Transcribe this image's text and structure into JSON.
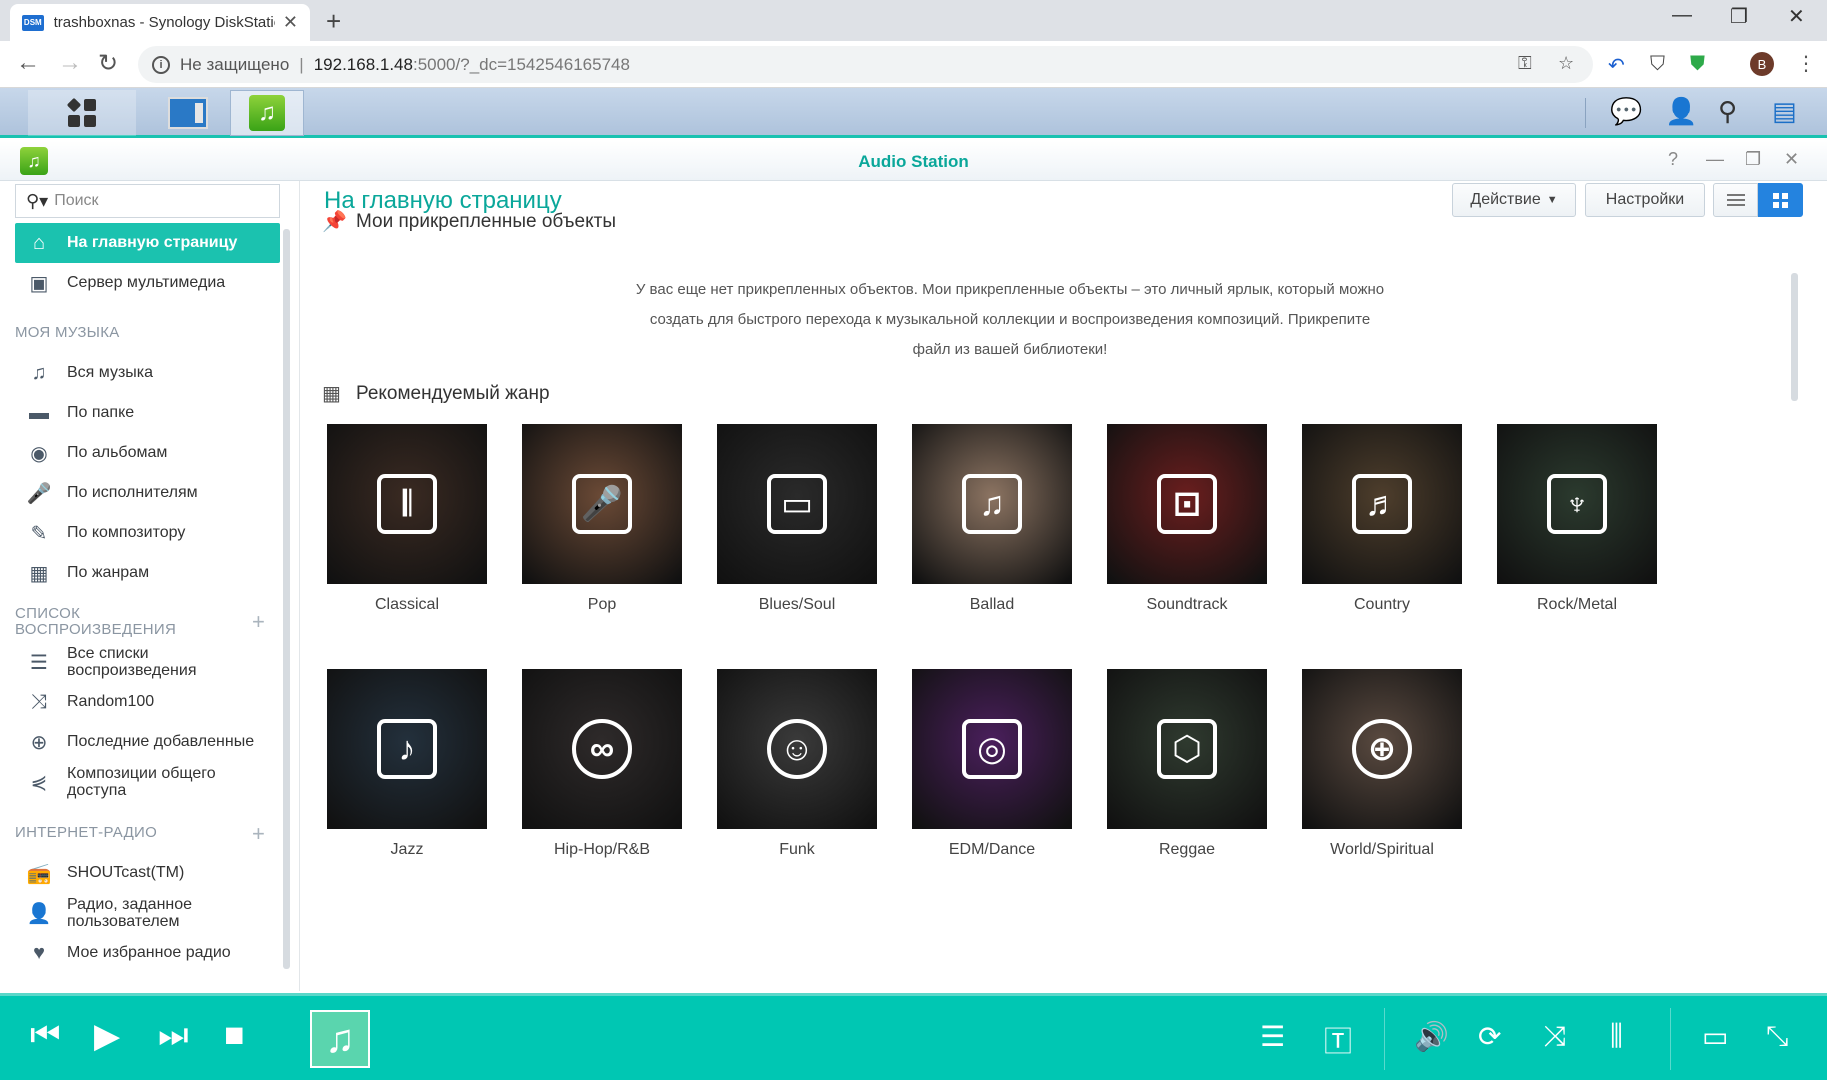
{
  "browser": {
    "tab_title": "trashboxnas - Synology DiskStation",
    "tab_favicon": "DSM",
    "security_label": "Не защищено",
    "url_host": "192.168.1.48",
    "url_path": ":5000/?_dc=1542546165748",
    "profile_letter": "B"
  },
  "app": {
    "title": "Audio Station"
  },
  "sidebar": {
    "search_placeholder": "Поиск",
    "top": [
      {
        "label": "На главную страницу",
        "icon": "home-icon",
        "active": true
      },
      {
        "label": "Сервер мультимедиа",
        "icon": "media-server-icon"
      }
    ],
    "my_music_header": "МОЯ МУЗЫКА",
    "my_music": [
      {
        "label": "Вся музыка",
        "icon": "music-note-icon"
      },
      {
        "label": "По папке",
        "icon": "folder-icon"
      },
      {
        "label": "По альбомам",
        "icon": "album-icon"
      },
      {
        "label": "По исполнителям",
        "icon": "microphone-icon"
      },
      {
        "label": "По композитору",
        "icon": "pen-icon"
      },
      {
        "label": "По жанрам",
        "icon": "genre-grid-icon"
      }
    ],
    "playlist_header": "СПИСОК ВОСПРОИЗВЕДЕНИЯ",
    "playlists": [
      {
        "label": "Все списки воспроизведения",
        "icon": "playlist-icon"
      },
      {
        "label": "Random100",
        "icon": "shuffle-icon"
      },
      {
        "label": "Последние добавленные",
        "icon": "plus-circle-icon"
      },
      {
        "label": "Композиции общего доступа",
        "icon": "share-icon"
      }
    ],
    "radio_header": "ИНТЕРНЕТ-РАДИО",
    "radio": [
      {
        "label": "SHOUTcast(TM)",
        "icon": "radio-icon"
      },
      {
        "label": "Радио, заданное пользователем",
        "icon": "user-icon"
      },
      {
        "label": "Мое избранное радио",
        "icon": "heart-icon"
      }
    ]
  },
  "main": {
    "page_title": "На главную страницу",
    "action_button": "Действие",
    "settings_button": "Настройки",
    "pinned_title": "Мои прикрепленные объекты",
    "pinned_empty": "У вас еще нет прикрепленных объектов. Мои прикрепленные объекты – это личный ярлык, который можно создать для быстрого перехода к музыкальной коллекции и воспроизведения композиций. Прикрепите файл из вашей библиотеки!",
    "genre_title": "Рекомендуемый жанр",
    "genres": [
      {
        "label": "Classical",
        "icon": "piano-icon",
        "color": "#3a2a22"
      },
      {
        "label": "Pop",
        "icon": "microphone-icon",
        "color": "#6b4a36"
      },
      {
        "label": "Blues/Soul",
        "icon": "harmonica-icon",
        "color": "#2a2a2a"
      },
      {
        "label": "Ballad",
        "icon": "music-note-icon",
        "color": "#8c7462"
      },
      {
        "label": "Soundtrack",
        "icon": "speakers-icon",
        "color": "#6a1e1e"
      },
      {
        "label": "Country",
        "icon": "guitar-icon",
        "color": "#4e3e2c"
      },
      {
        "label": "Rock/Metal",
        "icon": "electric-guitar-icon",
        "color": "#2b3a2e"
      },
      {
        "label": "Jazz",
        "icon": "saxophone-icon",
        "color": "#23303c"
      },
      {
        "label": "Hip-Hop/R&B",
        "icon": "sunglasses-icon",
        "color": "#2e2a2a"
      },
      {
        "label": "Funk",
        "icon": "afro-icon",
        "color": "#3a3a3a"
      },
      {
        "label": "EDM/Dance",
        "icon": "boombox-icon",
        "color": "#4a1f5c"
      },
      {
        "label": "Reggae",
        "icon": "lion-icon",
        "color": "#2f3a2f"
      },
      {
        "label": "World/Spiritual",
        "icon": "globe-icon",
        "color": "#5a4a40"
      }
    ]
  }
}
